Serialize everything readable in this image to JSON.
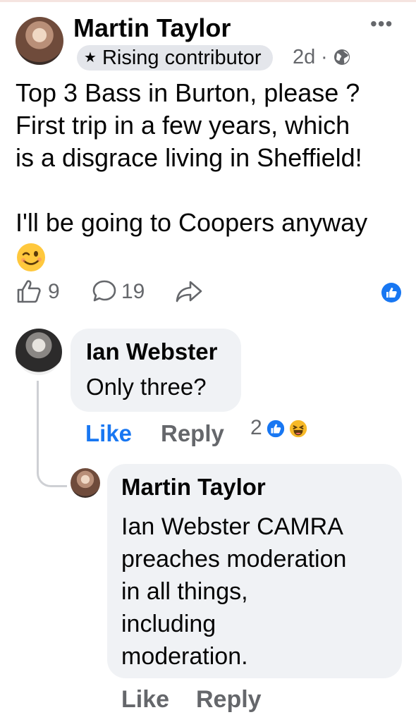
{
  "post": {
    "author": "Martin Taylor",
    "badge": "Rising contributor",
    "time": "2d",
    "separator": "·",
    "text_lines": [
      "Top 3 Bass in Burton, please ?",
      "First trip in a few years, which",
      "is a disgrace living in Sheffield!",
      "",
      "I'll be going to Coopers anyway"
    ],
    "like_count": "9",
    "comment_count": "19",
    "icons": {
      "more": "more-icon",
      "badge": "star-icon",
      "privacy": "globe-icon",
      "emoji": "winking-face-icon",
      "like": "thumbs-up-icon",
      "comment": "comment-icon",
      "share": "share-icon",
      "reaction": "like-reaction-icon"
    }
  },
  "comments": [
    {
      "author": "Ian Webster",
      "text": "Only three?",
      "like_label": "Like",
      "reply_label": "Reply",
      "reaction_count": "2",
      "reactions": [
        "like-reaction-icon",
        "haha-reaction-icon"
      ]
    },
    {
      "author": "Martin Taylor",
      "text_lines": [
        "Ian Webster CAMRA",
        "preaches moderation",
        "in all things,",
        "including",
        "moderation."
      ],
      "like_label": "Like",
      "reply_label": "Reply"
    }
  ],
  "colors": {
    "accent": "#1877f2",
    "secondary_text": "#65676b",
    "bubble": "#f0f2f5",
    "badge_bg": "#e4e6eb"
  }
}
